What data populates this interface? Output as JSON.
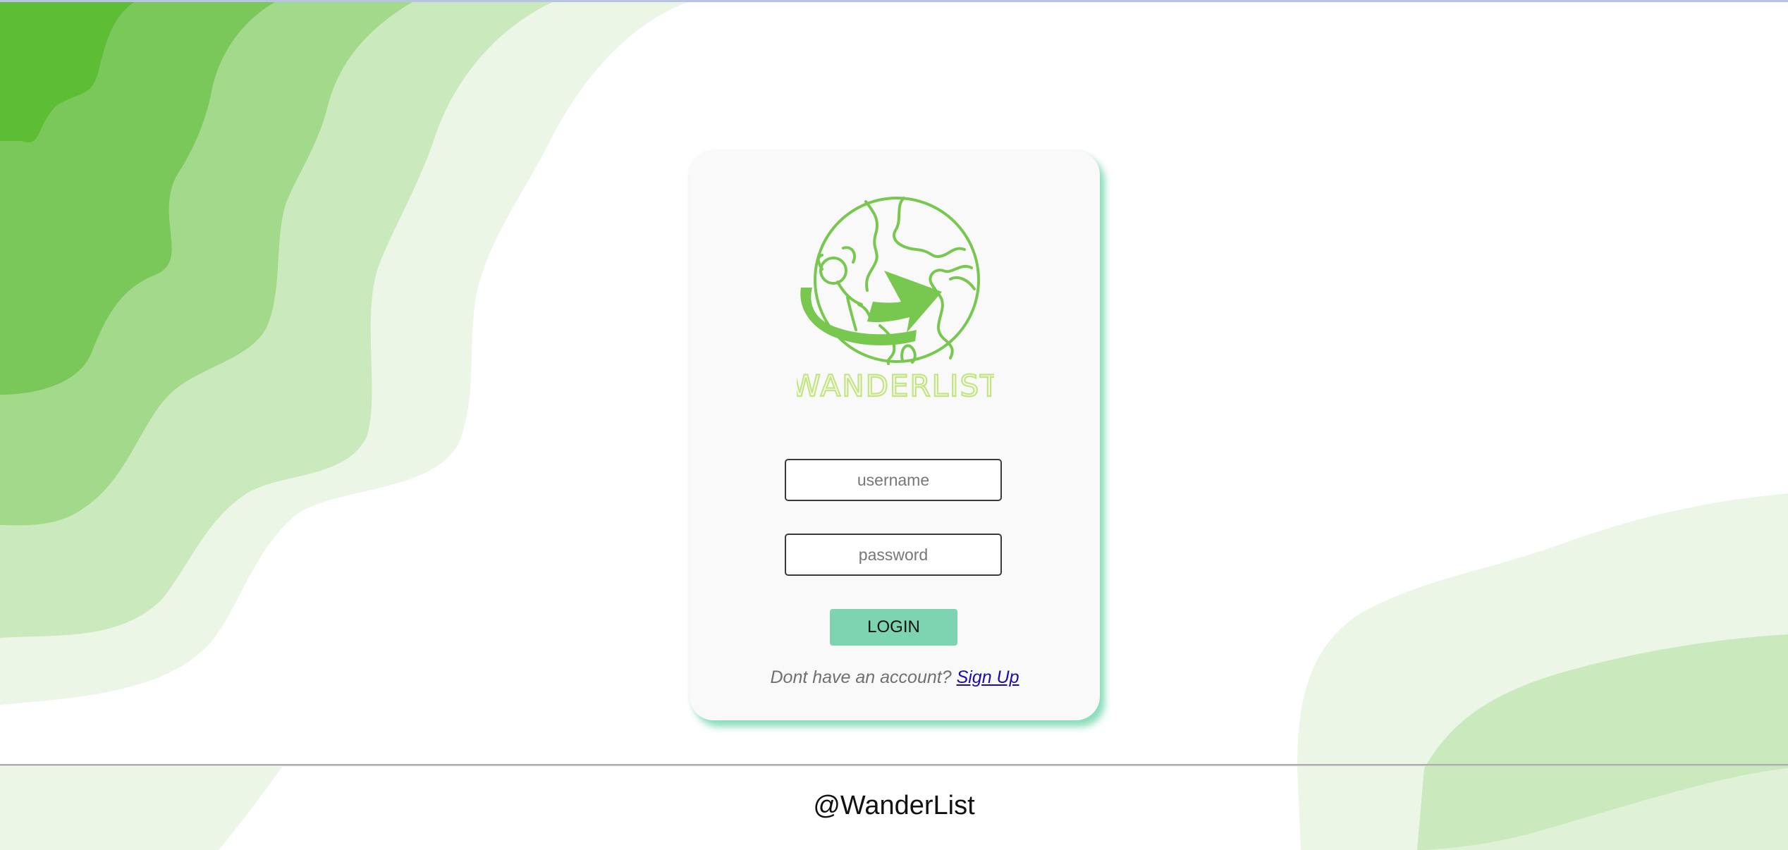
{
  "login_form": {
    "username_placeholder": "username",
    "password_placeholder": "password",
    "login_label": "LOGIN",
    "signup_prompt": "Dont have an account?",
    "signup_link": "Sign Up"
  },
  "branding": {
    "logo_text": "WANDERLIST",
    "logo_icon": "globe-traveler-arrow-icon"
  },
  "footer": {
    "text": "@WanderList"
  },
  "colors": {
    "brand_green": "#78c850",
    "logo_text_yellow_green": "#c3e680",
    "button_mint": "#7dd4b0",
    "card_background": "#f9f9f9",
    "wave_dark": "#5dbe35",
    "wave_mid": "#7ac85a",
    "wave_light": "#a3d98a",
    "wave_pale": "#caeabe",
    "wave_palest": "#ebf6e6"
  }
}
